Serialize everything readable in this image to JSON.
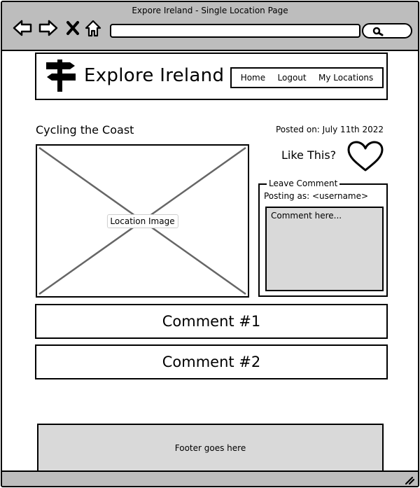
{
  "window": {
    "title": "Expore Ireland - Single Location Page"
  },
  "browser": {
    "url_value": "",
    "icons": [
      "back-arrow-icon",
      "forward-arrow-icon",
      "close-x-icon",
      "home-icon",
      "search-icon",
      "resize-grip-icon"
    ]
  },
  "site": {
    "title": "Explore Ireland",
    "logo_icon": "signpost-icon"
  },
  "nav": {
    "items": [
      {
        "label": "Home"
      },
      {
        "label": "Logout"
      },
      {
        "label": "My Locations"
      }
    ]
  },
  "location": {
    "title": "Cycling the Coast",
    "posted": "Posted on: July 11th 2022",
    "image_label": "Location Image"
  },
  "like": {
    "label": "Like This?",
    "icon": "heart-icon"
  },
  "leave_comment": {
    "legend": "Leave Comment",
    "posting_as": "Posting as: <username>",
    "placeholder": "Comment here..."
  },
  "comments": [
    {
      "label": "Comment #1"
    },
    {
      "label": "Comment #2"
    }
  ],
  "footer": {
    "text": "Footer goes here"
  },
  "colors": {
    "chrome": "#bdbdbd",
    "panel_fill": "#d9d9d9",
    "ink": "#000000"
  }
}
